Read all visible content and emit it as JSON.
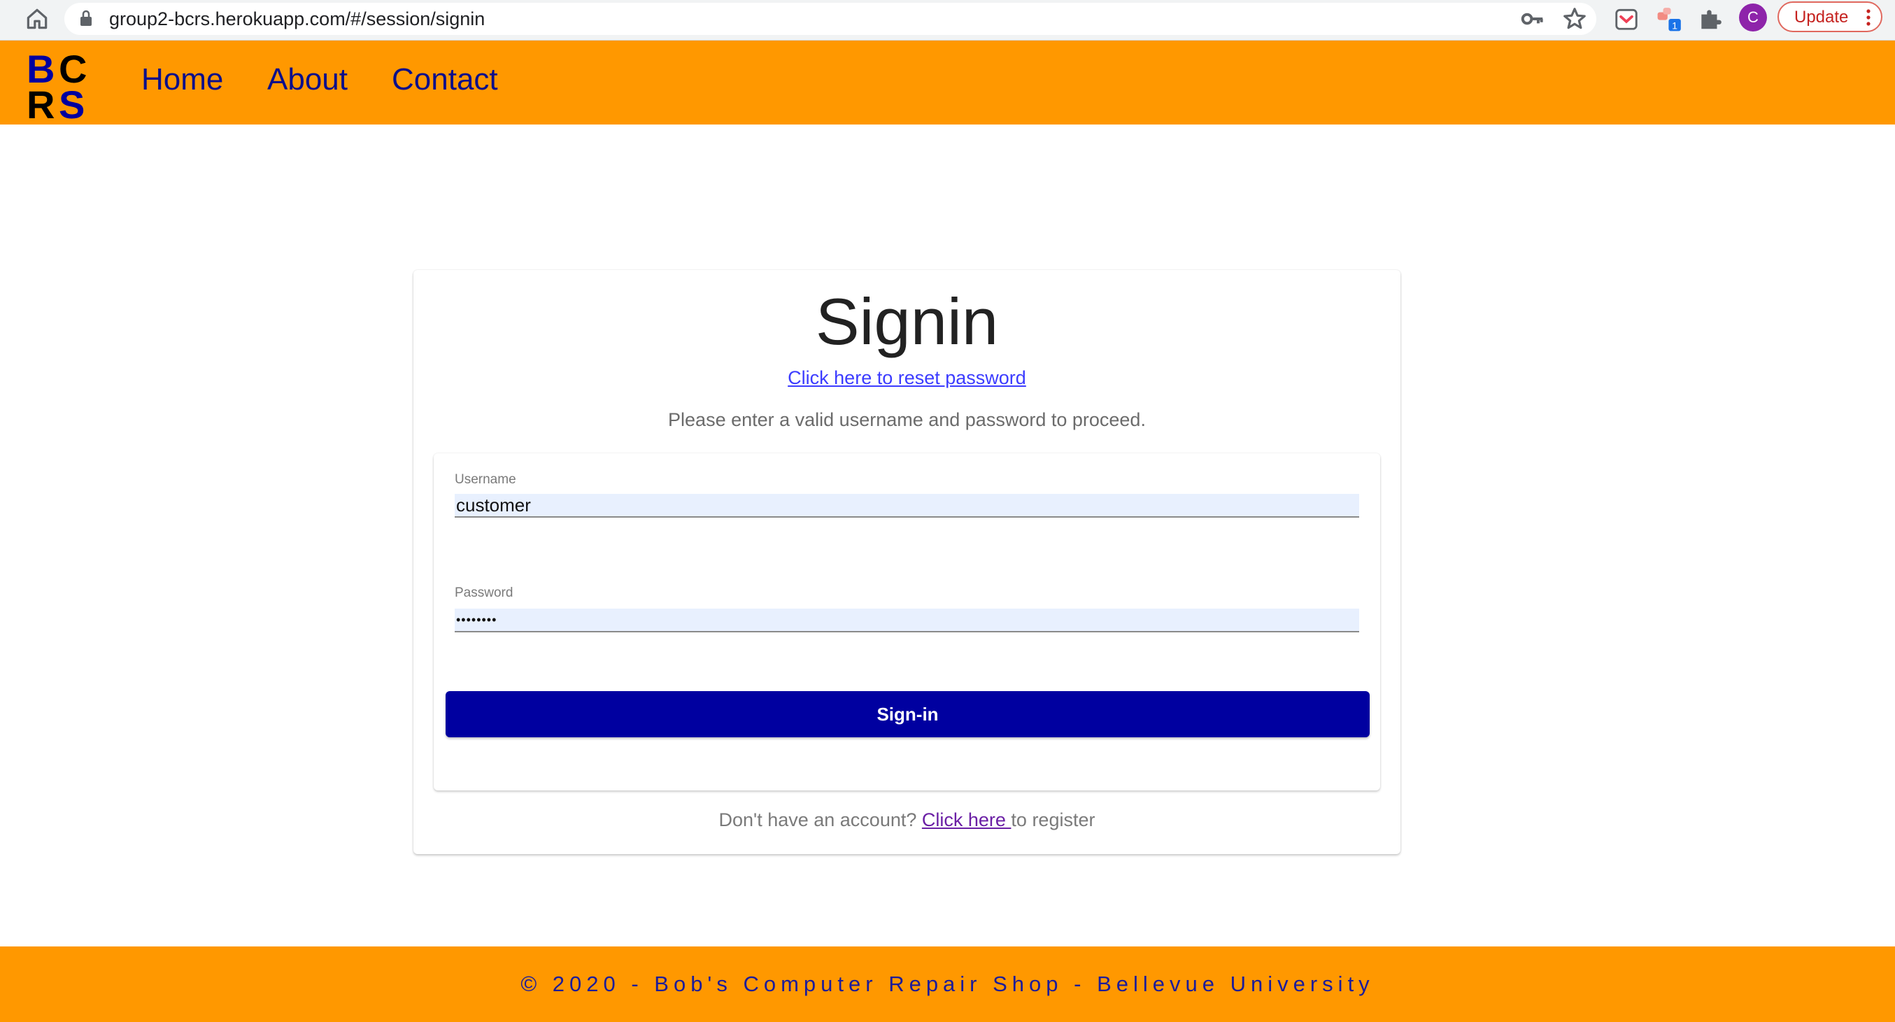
{
  "browser": {
    "url": "group2-bcrs.herokuapp.com/#/session/signin",
    "avatar_letter": "C",
    "update_label": "Update",
    "extension_badge": "1"
  },
  "navbar": {
    "logo_letters": [
      "B",
      "C",
      "R",
      "S"
    ],
    "links": [
      "Home",
      "About",
      "Contact"
    ]
  },
  "signin": {
    "title": "Signin",
    "reset_link": "Click here to reset password",
    "instructions": "Please enter a valid username and password to proceed.",
    "username_label": "Username",
    "username_value": "customer",
    "password_label": "Password",
    "password_value": "••••••••",
    "button_label": "Sign-in",
    "register_prefix": "Don't have an account? ",
    "register_link": "Click here ",
    "register_suffix": "to register"
  },
  "footer": {
    "text": "© 2020 - Bob's Computer Repair Shop - Bellevue University"
  },
  "colors": {
    "brand_orange": "#ff9800",
    "brand_navy": "#0000a0",
    "nav_text": "#0b0f8a"
  }
}
